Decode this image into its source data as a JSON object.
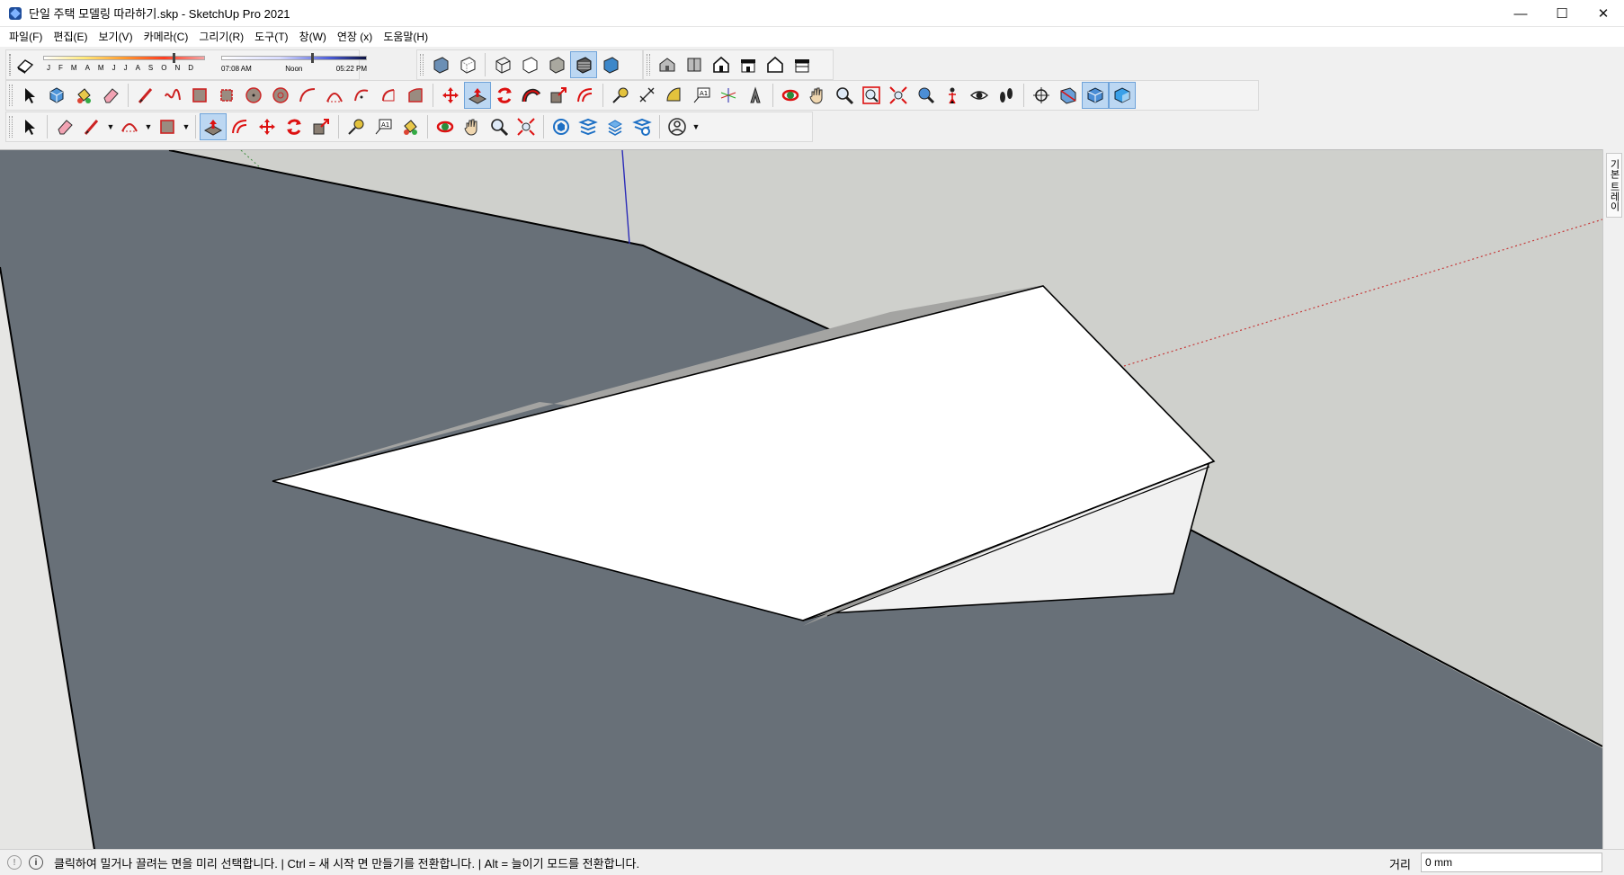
{
  "window": {
    "title": "단일 주택 모델링 따라하기.skp - SketchUp Pro 2021",
    "minimize": "—",
    "maximize": "☐",
    "close": "✕"
  },
  "menu": [
    "파일(F)",
    "편집(E)",
    "보기(V)",
    "카메라(C)",
    "그리기(R)",
    "도구(T)",
    "창(W)",
    "연장 (x)",
    "도움말(H)"
  ],
  "shadows": {
    "months": [
      "J",
      "F",
      "M",
      "A",
      "M",
      "J",
      "J",
      "A",
      "S",
      "O",
      "N",
      "D"
    ],
    "time_start": "07:08 AM",
    "time_mid": "Noon",
    "time_end": "05:22 PM",
    "month_fraction": 0.8,
    "time_fraction": 0.62
  },
  "tray": {
    "label": "기본 트레이"
  },
  "status": {
    "message": "클릭하여 밀거나 끌려는 면을 미리 선택합니다. | Ctrl = 새 시작 면 만들기를 전환합니다. | Alt = 늘이기 모드를 전환합니다.",
    "measure_label": "거리",
    "measure_value": "0 mm"
  },
  "colors": {
    "sky": "#cfd0cc",
    "ground": "#687078",
    "face": "#ffffff",
    "active_tool": "#bcd7f2"
  }
}
